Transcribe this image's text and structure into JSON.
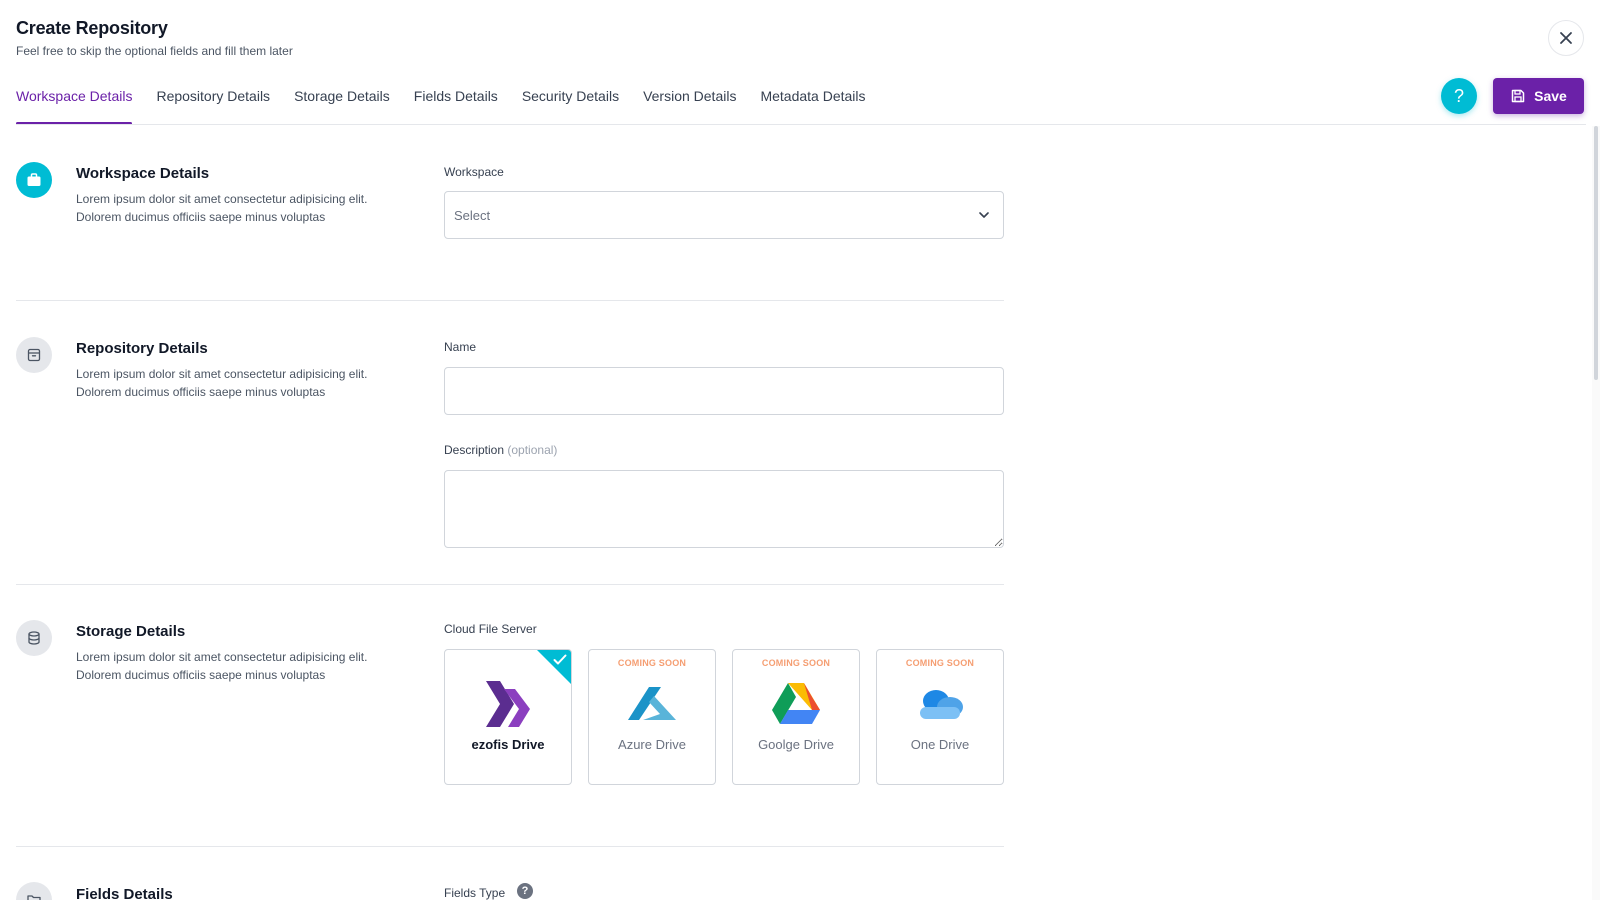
{
  "header": {
    "title": "Create Repository",
    "subtitle": "Feel free to skip the optional fields and fill them later"
  },
  "tabs": [
    {
      "label": "Workspace Details",
      "active": true
    },
    {
      "label": "Repository Details",
      "active": false
    },
    {
      "label": "Storage Details",
      "active": false
    },
    {
      "label": "Fields Details",
      "active": false
    },
    {
      "label": "Security Details",
      "active": false
    },
    {
      "label": "Version Details",
      "active": false
    },
    {
      "label": "Metadata Details",
      "active": false
    }
  ],
  "actions": {
    "help_symbol": "?",
    "save_label": "Save"
  },
  "sections": {
    "workspace": {
      "title": "Workspace Details",
      "description": "Lorem ipsum dolor sit amet consectetur adipisicing elit. Dolorem ducimus officiis saepe minus voluptas",
      "field_label": "Workspace",
      "select_placeholder": "Select",
      "icon": "briefcase-icon"
    },
    "repository": {
      "title": "Repository Details",
      "description": "Lorem ipsum dolor sit amet consectetur adipisicing elit. Dolorem ducimus officiis saepe minus voluptas",
      "name_label": "Name",
      "name_value": "",
      "description_label": "Description",
      "description_optional": "(optional)",
      "description_value": "",
      "icon": "archive-icon"
    },
    "storage": {
      "title": "Storage Details",
      "description": "Lorem ipsum dolor sit amet consectetur adipisicing elit. Dolorem ducimus officiis saepe minus voluptas",
      "field_label": "Cloud File Server",
      "icon": "database-icon",
      "drives": [
        {
          "name": "ezofis Drive",
          "badge": "",
          "selected": true,
          "icon": "ezofis-logo-icon"
        },
        {
          "name": "Azure Drive",
          "badge": "COMING SOON",
          "selected": false,
          "icon": "azure-logo-icon"
        },
        {
          "name": "Goolge Drive",
          "badge": "COMING SOON",
          "selected": false,
          "icon": "google-drive-logo-icon"
        },
        {
          "name": "One Drive",
          "badge": "COMING SOON",
          "selected": false,
          "icon": "onedrive-logo-icon"
        }
      ]
    },
    "fields": {
      "title": "Fields Details",
      "field_label": "Fields Type",
      "help_symbol": "?",
      "icon": "folder-icon"
    }
  },
  "colors": {
    "primary": "#6b21a8",
    "accent": "#00bcd4",
    "coming_soon": "#f59e72"
  }
}
